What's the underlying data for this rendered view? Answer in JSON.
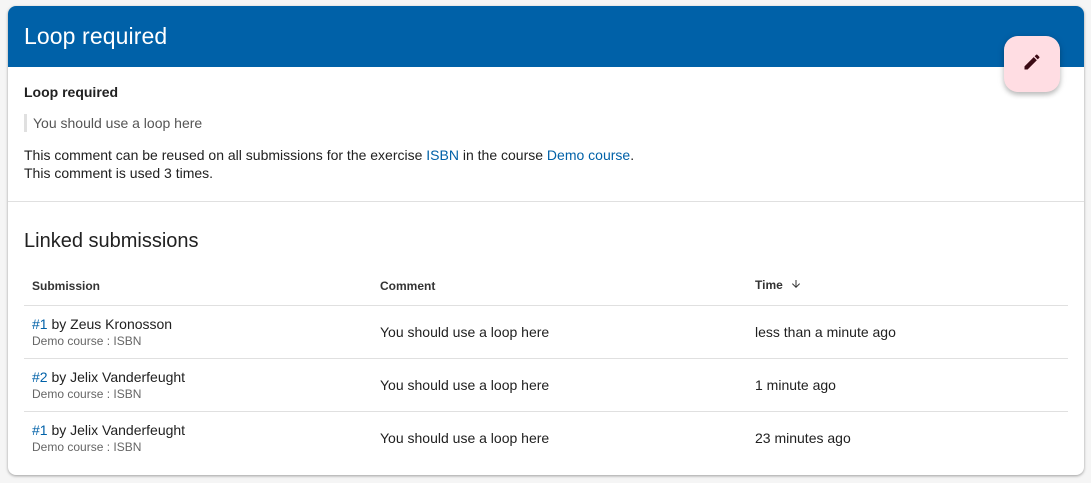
{
  "header": {
    "title": "Loop required",
    "edit_icon": "pencil-icon",
    "accent_color": "#0061a8",
    "fab_color": "#ffdde3"
  },
  "comment": {
    "name": "Loop required",
    "quote": "You should use a loop here",
    "info_prefix": "This comment can be reused on all submissions for the exercise ",
    "exercise_link": "ISBN",
    "info_middle": " in the course ",
    "course_link": "Demo course",
    "info_suffix": ".",
    "usage": "This comment is used 3 times."
  },
  "linked": {
    "title": "Linked submissions",
    "columns": {
      "submission": "Submission",
      "comment": "Comment",
      "time": "Time",
      "sort_icon": "arrow-down-icon"
    },
    "rows": [
      {
        "id_link": "#1",
        "by": " by Zeus Kronosson",
        "meta": "Demo course : ISBN",
        "comment": "You should use a loop here",
        "time": "less than a minute ago"
      },
      {
        "id_link": "#2",
        "by": " by Jelix Vanderfeught",
        "meta": "Demo course : ISBN",
        "comment": "You should use a loop here",
        "time": "1 minute ago"
      },
      {
        "id_link": "#1",
        "by": " by Jelix Vanderfeught",
        "meta": "Demo course : ISBN",
        "comment": "You should use a loop here",
        "time": "23 minutes ago"
      }
    ]
  }
}
